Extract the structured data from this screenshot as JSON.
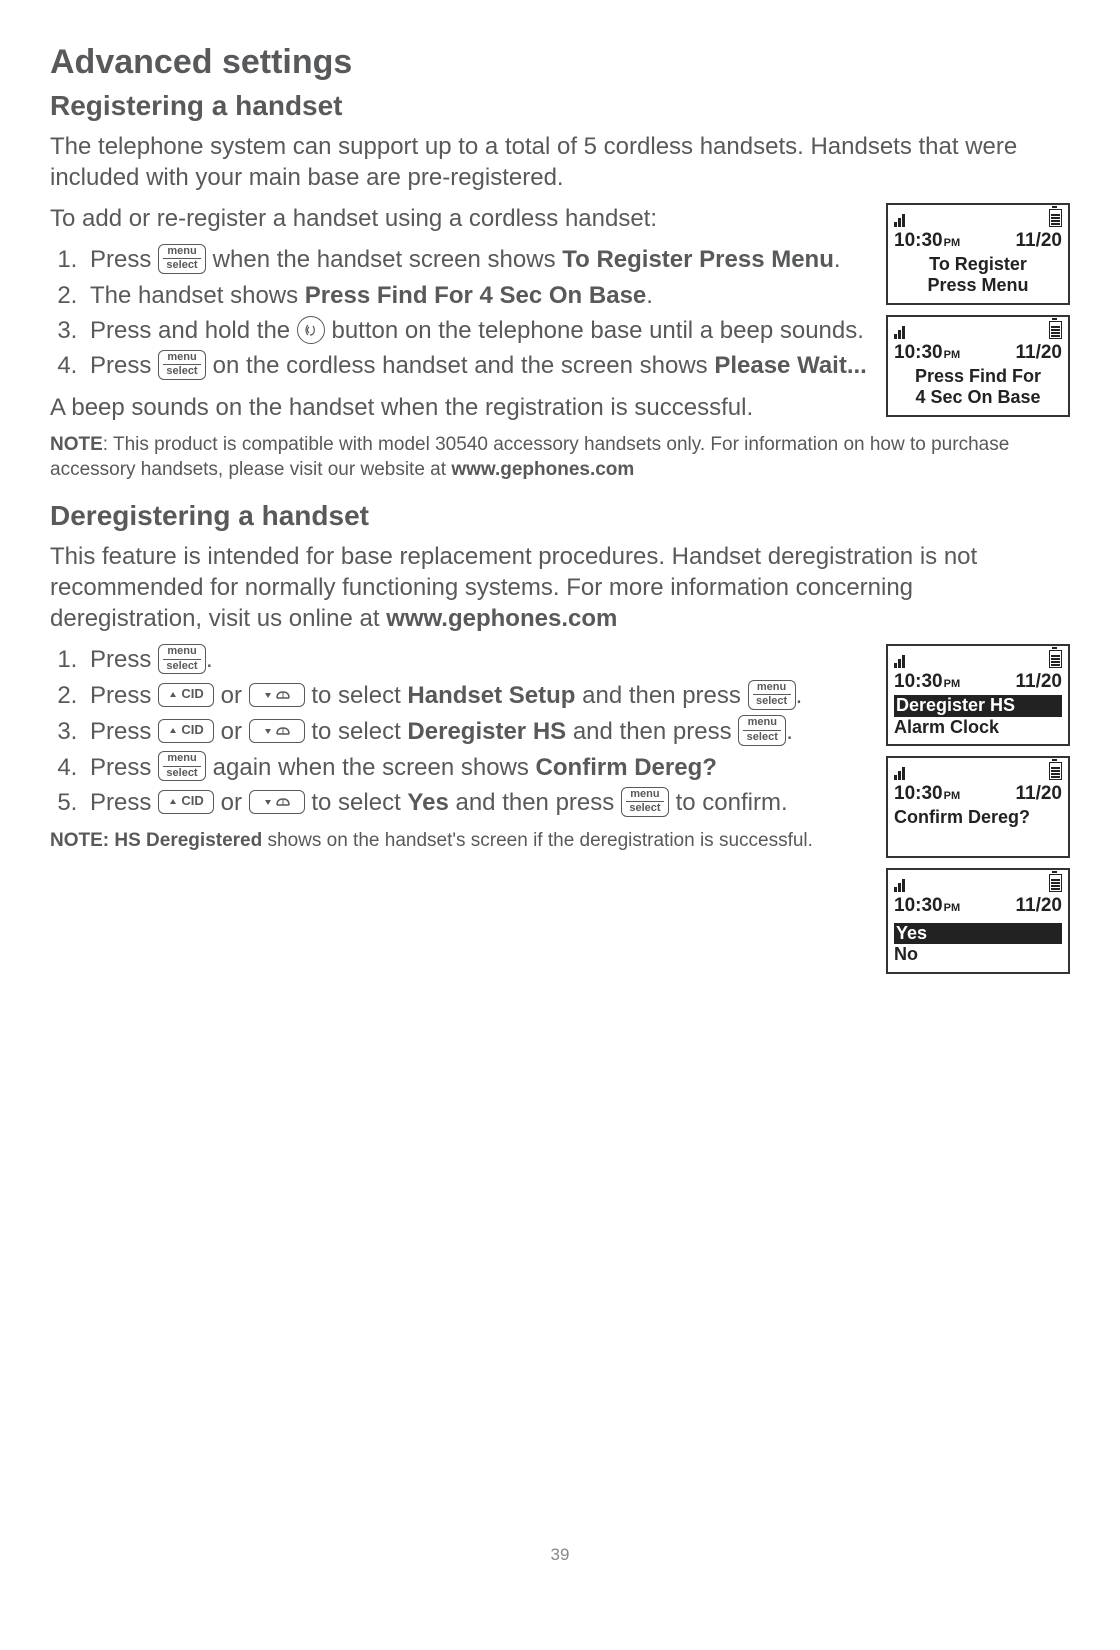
{
  "page": {
    "title": "Advanced settings",
    "number": "39"
  },
  "section1": {
    "heading": "Registering a handset",
    "para1": "The telephone system can support up to a total of 5 cordless handsets. Handsets that were included with your main base are pre-registered.",
    "para2": "To add or re-register a handset using a cordless handset:",
    "step1_a": "Press ",
    "step1_b": " when the handset screen shows ",
    "step1_bold": "To Register Press Menu",
    "step2_a": "The handset shows ",
    "step2_bold": "Press Find For 4 Sec On Base",
    "step3_a": "Press and hold the ",
    "step3_b": " button on the telephone base until a beep sounds.",
    "step4_a": "Press ",
    "step4_b": " on the cordless handset and the screen shows ",
    "step4_bold": "Please Wait...",
    "para3": "A beep sounds on the handset when the registration is successful.",
    "note_bold": "NOTE",
    "note_a": ": This product is compatible with model 30540 accessory handsets only. For information on how to purchase accessory handsets, please visit our website at ",
    "note_url": "www.gephones.com"
  },
  "section2": {
    "heading": "Deregistering a handset",
    "para1_a": "This feature is intended for base replacement procedures. Handset deregistration is not recommended for normally functioning systems. For more information concerning deregistration, visit us online at ",
    "para1_url": "www.gephones.com",
    "step1_a": "Press ",
    "step2_a": "Press ",
    "step2_b": " or ",
    "step2_c": " to select ",
    "step2_bold": "Handset Setup",
    "step2_d": " and then press ",
    "step3_a": "Press ",
    "step3_b": " or ",
    "step3_c": " to select ",
    "step3_bold": "Deregister HS",
    "step3_d": " and then press ",
    "step4_a": "Press ",
    "step4_b": " again when the screen shows ",
    "step4_bold": "Confirm Dereg?",
    "step5_a": "Press ",
    "step5_b": " or ",
    "step5_c": " to select ",
    "step5_bold": "Yes",
    "step5_d": " and then press ",
    "step5_e": " to confirm.",
    "note_bold": "NOTE: HS Deregistered",
    "note_rest": " shows on the handset's screen if the deregistration is successful."
  },
  "keys": {
    "menu_top": "menu",
    "menu_bot": "select",
    "cid": "CID"
  },
  "screens": {
    "time": "10:30",
    "pm": "PM",
    "date": "11/20",
    "s1_l1": "To Register",
    "s1_l2": "Press Menu",
    "s2_l1": "Press Find For",
    "s2_l2": "4 Sec On Base",
    "s3_l1": "Deregister HS",
    "s3_l2": "Alarm Clock",
    "s4_l1": "Confirm Dereg?",
    "s5_l1": "Yes",
    "s5_l2": "No"
  }
}
